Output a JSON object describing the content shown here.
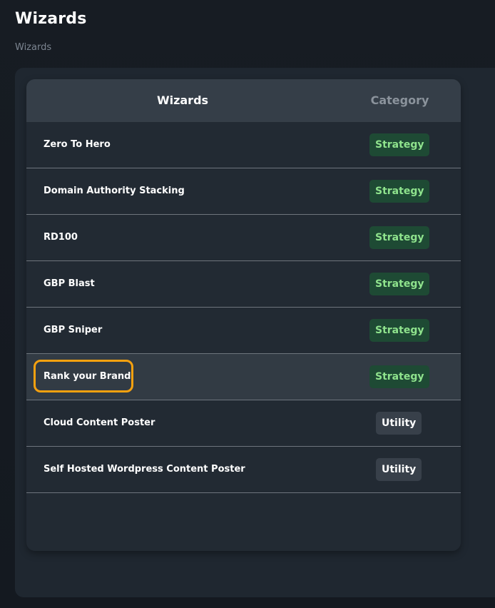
{
  "page": {
    "title": "Wizards",
    "breadcrumb": "Wizards"
  },
  "table": {
    "headers": {
      "wizards": "Wizards",
      "category": "Category"
    },
    "rows": [
      {
        "name": "Zero To Hero",
        "category": "Strategy",
        "type": "strategy"
      },
      {
        "name": "Domain Authority Stacking",
        "category": "Strategy",
        "type": "strategy"
      },
      {
        "name": "RD100",
        "category": "Strategy",
        "type": "strategy"
      },
      {
        "name": "GBP Blast",
        "category": "Strategy",
        "type": "strategy"
      },
      {
        "name": "GBP Sniper",
        "category": "Strategy",
        "type": "strategy"
      },
      {
        "name": "Rank your Brand",
        "category": "Strategy",
        "type": "strategy",
        "selected": true,
        "highlighted": true
      },
      {
        "name": "Cloud Content Poster",
        "category": "Utility",
        "type": "utility"
      },
      {
        "name": "Self Hosted Wordpress Content Poster",
        "category": "Utility",
        "type": "utility"
      }
    ]
  },
  "colors": {
    "background": "#161b22",
    "panel": "#1f2730",
    "card": "#222a33",
    "header": "#353e48",
    "strategy_badge_bg": "#1e4a34",
    "strategy_badge_text": "#8fe38d",
    "utility_badge_bg": "#38404a",
    "highlight": "#f5a10f"
  }
}
